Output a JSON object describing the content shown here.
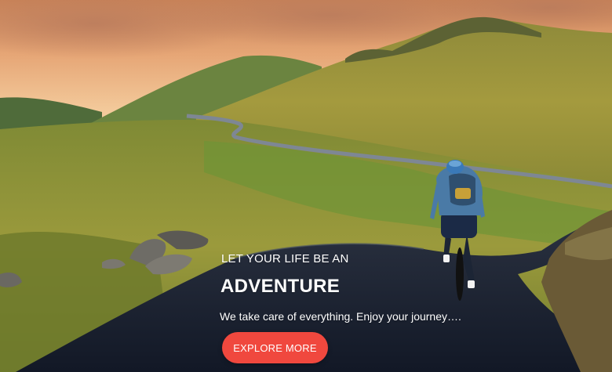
{
  "hero": {
    "tagline": "LET YOUR LIFE BE AN",
    "headline": "ADVENTURE",
    "subtitle": "We take care of everything. Enjoy your journey….",
    "cta_label": "EXPLORE MORE"
  },
  "colors": {
    "cta_background": "#f0483e",
    "text": "#ffffff"
  }
}
